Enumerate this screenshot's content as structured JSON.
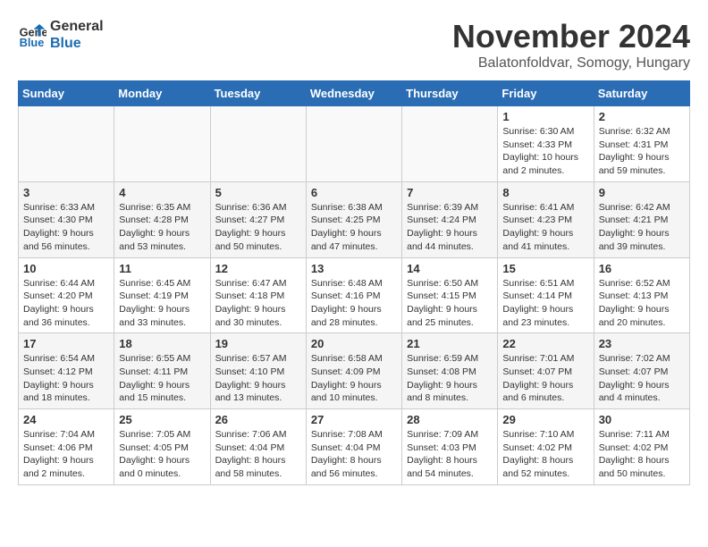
{
  "header": {
    "logo_general": "General",
    "logo_blue": "Blue",
    "month_title": "November 2024",
    "location": "Balatonfoldvar, Somogy, Hungary"
  },
  "days_of_week": [
    "Sunday",
    "Monday",
    "Tuesday",
    "Wednesday",
    "Thursday",
    "Friday",
    "Saturday"
  ],
  "weeks": [
    [
      {
        "day": "",
        "info": ""
      },
      {
        "day": "",
        "info": ""
      },
      {
        "day": "",
        "info": ""
      },
      {
        "day": "",
        "info": ""
      },
      {
        "day": "",
        "info": ""
      },
      {
        "day": "1",
        "info": "Sunrise: 6:30 AM\nSunset: 4:33 PM\nDaylight: 10 hours\nand 2 minutes."
      },
      {
        "day": "2",
        "info": "Sunrise: 6:32 AM\nSunset: 4:31 PM\nDaylight: 9 hours\nand 59 minutes."
      }
    ],
    [
      {
        "day": "3",
        "info": "Sunrise: 6:33 AM\nSunset: 4:30 PM\nDaylight: 9 hours\nand 56 minutes."
      },
      {
        "day": "4",
        "info": "Sunrise: 6:35 AM\nSunset: 4:28 PM\nDaylight: 9 hours\nand 53 minutes."
      },
      {
        "day": "5",
        "info": "Sunrise: 6:36 AM\nSunset: 4:27 PM\nDaylight: 9 hours\nand 50 minutes."
      },
      {
        "day": "6",
        "info": "Sunrise: 6:38 AM\nSunset: 4:25 PM\nDaylight: 9 hours\nand 47 minutes."
      },
      {
        "day": "7",
        "info": "Sunrise: 6:39 AM\nSunset: 4:24 PM\nDaylight: 9 hours\nand 44 minutes."
      },
      {
        "day": "8",
        "info": "Sunrise: 6:41 AM\nSunset: 4:23 PM\nDaylight: 9 hours\nand 41 minutes."
      },
      {
        "day": "9",
        "info": "Sunrise: 6:42 AM\nSunset: 4:21 PM\nDaylight: 9 hours\nand 39 minutes."
      }
    ],
    [
      {
        "day": "10",
        "info": "Sunrise: 6:44 AM\nSunset: 4:20 PM\nDaylight: 9 hours\nand 36 minutes."
      },
      {
        "day": "11",
        "info": "Sunrise: 6:45 AM\nSunset: 4:19 PM\nDaylight: 9 hours\nand 33 minutes."
      },
      {
        "day": "12",
        "info": "Sunrise: 6:47 AM\nSunset: 4:18 PM\nDaylight: 9 hours\nand 30 minutes."
      },
      {
        "day": "13",
        "info": "Sunrise: 6:48 AM\nSunset: 4:16 PM\nDaylight: 9 hours\nand 28 minutes."
      },
      {
        "day": "14",
        "info": "Sunrise: 6:50 AM\nSunset: 4:15 PM\nDaylight: 9 hours\nand 25 minutes."
      },
      {
        "day": "15",
        "info": "Sunrise: 6:51 AM\nSunset: 4:14 PM\nDaylight: 9 hours\nand 23 minutes."
      },
      {
        "day": "16",
        "info": "Sunrise: 6:52 AM\nSunset: 4:13 PM\nDaylight: 9 hours\nand 20 minutes."
      }
    ],
    [
      {
        "day": "17",
        "info": "Sunrise: 6:54 AM\nSunset: 4:12 PM\nDaylight: 9 hours\nand 18 minutes."
      },
      {
        "day": "18",
        "info": "Sunrise: 6:55 AM\nSunset: 4:11 PM\nDaylight: 9 hours\nand 15 minutes."
      },
      {
        "day": "19",
        "info": "Sunrise: 6:57 AM\nSunset: 4:10 PM\nDaylight: 9 hours\nand 13 minutes."
      },
      {
        "day": "20",
        "info": "Sunrise: 6:58 AM\nSunset: 4:09 PM\nDaylight: 9 hours\nand 10 minutes."
      },
      {
        "day": "21",
        "info": "Sunrise: 6:59 AM\nSunset: 4:08 PM\nDaylight: 9 hours\nand 8 minutes."
      },
      {
        "day": "22",
        "info": "Sunrise: 7:01 AM\nSunset: 4:07 PM\nDaylight: 9 hours\nand 6 minutes."
      },
      {
        "day": "23",
        "info": "Sunrise: 7:02 AM\nSunset: 4:07 PM\nDaylight: 9 hours\nand 4 minutes."
      }
    ],
    [
      {
        "day": "24",
        "info": "Sunrise: 7:04 AM\nSunset: 4:06 PM\nDaylight: 9 hours\nand 2 minutes."
      },
      {
        "day": "25",
        "info": "Sunrise: 7:05 AM\nSunset: 4:05 PM\nDaylight: 9 hours\nand 0 minutes."
      },
      {
        "day": "26",
        "info": "Sunrise: 7:06 AM\nSunset: 4:04 PM\nDaylight: 8 hours\nand 58 minutes."
      },
      {
        "day": "27",
        "info": "Sunrise: 7:08 AM\nSunset: 4:04 PM\nDaylight: 8 hours\nand 56 minutes."
      },
      {
        "day": "28",
        "info": "Sunrise: 7:09 AM\nSunset: 4:03 PM\nDaylight: 8 hours\nand 54 minutes."
      },
      {
        "day": "29",
        "info": "Sunrise: 7:10 AM\nSunset: 4:02 PM\nDaylight: 8 hours\nand 52 minutes."
      },
      {
        "day": "30",
        "info": "Sunrise: 7:11 AM\nSunset: 4:02 PM\nDaylight: 8 hours\nand 50 minutes."
      }
    ]
  ]
}
